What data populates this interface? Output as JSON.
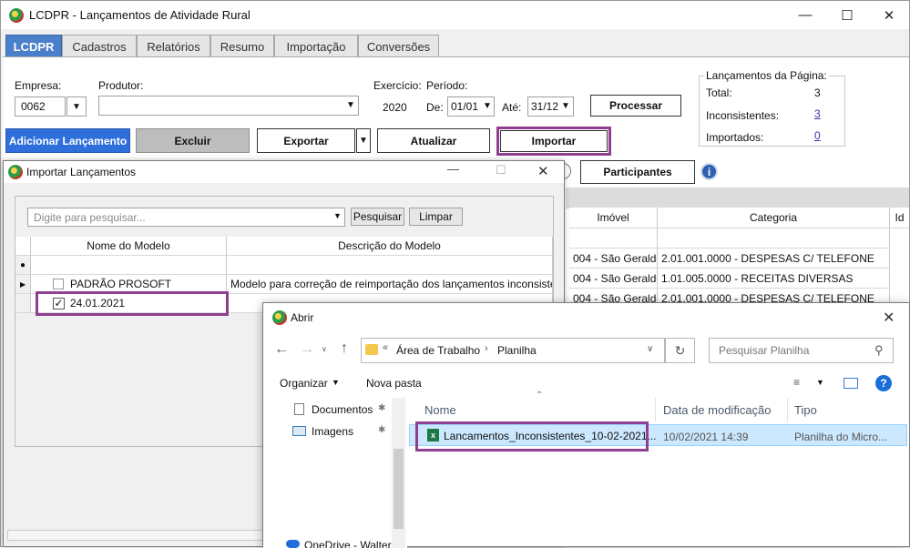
{
  "app": {
    "title": "LCDPR - Lançamentos de Atividade Rural",
    "tabs": [
      "LCDPR",
      "Cadastros",
      "Relatórios",
      "Resumo",
      "Importação",
      "Conversões"
    ]
  },
  "form": {
    "empresa_label": "Empresa:",
    "empresa_value": "0062",
    "produtor_label": "Produtor:",
    "produtor_value": "",
    "exercicio_label": "Exercício:",
    "exercicio_value": "2020",
    "periodo_label": "Período:",
    "de_label": "De:",
    "de_value": "01/01",
    "ate_label": "Até:",
    "ate_value": "31/12",
    "processar": "Processar"
  },
  "summary": {
    "title": "Lançamentos da Página:",
    "total_label": "Total:",
    "total_value": "3",
    "inconsistentes_label": "Inconsistentes:",
    "inconsistentes_value": "3",
    "importados_label": "Importados:",
    "importados_value": "0"
  },
  "actions": {
    "adicionar": "Adicionar Lançamento",
    "excluir": "Excluir",
    "exportar": "Exportar",
    "atualizar": "Atualizar",
    "importar": "Importar",
    "participantes": "Participantes"
  },
  "grid": {
    "headers": [
      "Imóvel",
      "Categoria",
      "Id"
    ],
    "rows": [
      {
        "imovel": "004 - São Geraldo",
        "categoria": "2.01.001.0000 - DESPESAS C/ TELEFONE"
      },
      {
        "imovel": "004 - São Geraldo",
        "categoria": "1.01.005.0000 - RECEITAS DIVERSAS"
      },
      {
        "imovel": "004 - São Geraldo",
        "categoria": "2.01.001.0000 - DESPESAS C/ TELEFONE"
      }
    ]
  },
  "import_dialog": {
    "title": "Importar Lançamentos",
    "search_placeholder": "Digite para pesquisar...",
    "pesquisar": "Pesquisar",
    "limpar": "Limpar",
    "col_nome": "Nome do Modelo",
    "col_descricao": "Descrição do Modelo",
    "rows": [
      {
        "checked": false,
        "nome": "PADRÃO PROSOFT",
        "descricao": "Modelo para correção de reimportação dos lançamentos inconsistente..."
      },
      {
        "checked": true,
        "nome": "24.01.2021",
        "descricao": ""
      }
    ]
  },
  "open_dialog": {
    "title": "Abrir",
    "path_parts": [
      "Área de Trabalho",
      "Planilha"
    ],
    "search_placeholder": "Pesquisar Planilha",
    "organizar": "Organizar",
    "nova_pasta": "Nova pasta",
    "nav_items": [
      "Documentos",
      "Imagens",
      "OneDrive - Walter"
    ],
    "col_nome": "Nome",
    "col_data": "Data de modificação",
    "col_tipo": "Tipo",
    "files": [
      {
        "name": "Lancamentos_Inconsistentes_10-02-2021...",
        "date": "10/02/2021 14:39",
        "type": "Planilha do Micro..."
      }
    ]
  },
  "colors": {
    "accent_blue": "#2f6fdc",
    "highlight_purple": "#8e3f8f",
    "tab_active": "#4a7fc9"
  }
}
